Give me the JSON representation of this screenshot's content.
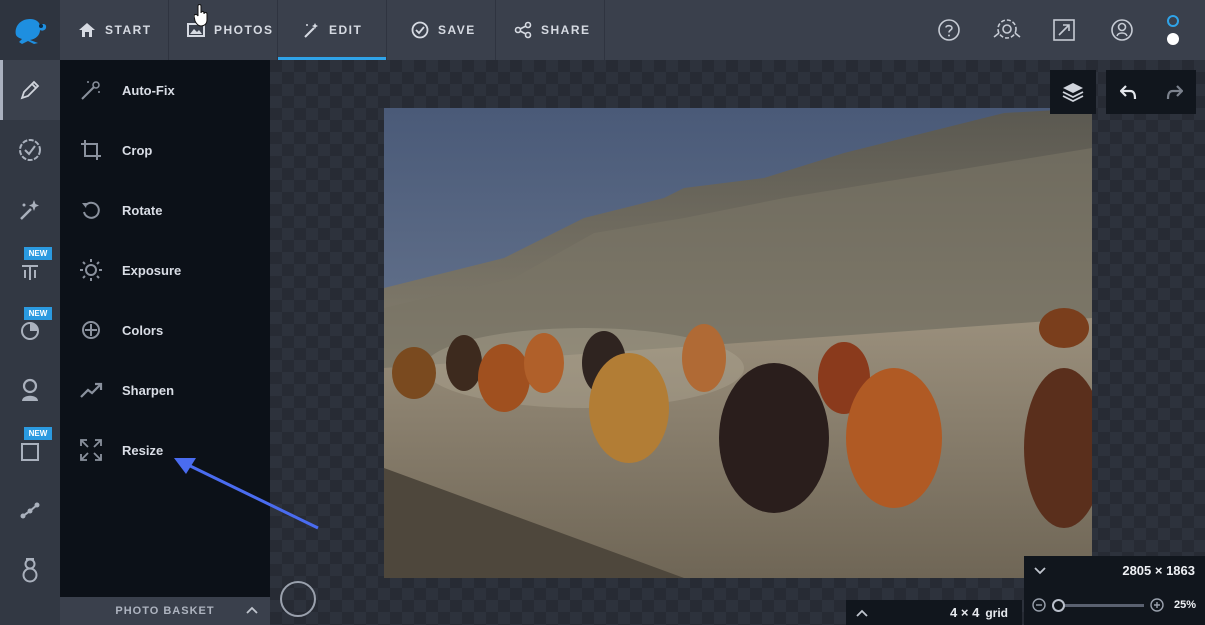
{
  "topbar": {
    "tabs": [
      {
        "id": "start",
        "label": "START",
        "icon": "home-icon"
      },
      {
        "id": "photos",
        "label": "PHOTOS",
        "icon": "image-icon"
      },
      {
        "id": "edit",
        "label": "EDIT",
        "icon": "magic-wand-icon",
        "active": true
      },
      {
        "id": "save",
        "label": "SAVE",
        "icon": "check-circle-icon"
      },
      {
        "id": "share",
        "label": "SHARE",
        "icon": "share-icon"
      }
    ],
    "right_icons": [
      "help-icon",
      "settings-gear-icon",
      "fullscreen-icon",
      "account-icon"
    ],
    "indicator_colors": [
      "#2fa3e8",
      "#ffffff"
    ]
  },
  "rail": {
    "items": [
      {
        "icon": "pencil-icon",
        "active": true,
        "badge": ""
      },
      {
        "icon": "badge-check-icon",
        "badge": ""
      },
      {
        "icon": "magic-sparkle-icon",
        "badge": ""
      },
      {
        "icon": "text-icon",
        "badge": "NEW"
      },
      {
        "icon": "overlay-icon",
        "badge": "NEW"
      },
      {
        "icon": "person-icon",
        "badge": ""
      },
      {
        "icon": "frame-icon",
        "badge": "NEW"
      },
      {
        "icon": "graph-nodes-icon",
        "badge": ""
      },
      {
        "icon": "snowman-icon",
        "badge": ""
      }
    ]
  },
  "panel": {
    "tools": [
      {
        "label": "Auto-Fix",
        "icon": "magic-wand-icon"
      },
      {
        "label": "Crop",
        "icon": "crop-icon"
      },
      {
        "label": "Rotate",
        "icon": "rotate-icon"
      },
      {
        "label": "Exposure",
        "icon": "sun-icon"
      },
      {
        "label": "Colors",
        "icon": "crosshair-icon"
      },
      {
        "label": "Sharpen",
        "icon": "trend-up-icon"
      },
      {
        "label": "Resize",
        "icon": "resize-icon"
      }
    ],
    "basket_label": "PHOTO BASKET"
  },
  "canvas": {
    "grid_label_value": "4 × 4",
    "grid_label_word": "grid",
    "dimensions": "2805 × 1863",
    "zoom": "25%",
    "zoom_fraction": 0.0
  },
  "colors": {
    "accent": "#2fa3e8",
    "annotation_arrow": "#4a6cf0"
  }
}
